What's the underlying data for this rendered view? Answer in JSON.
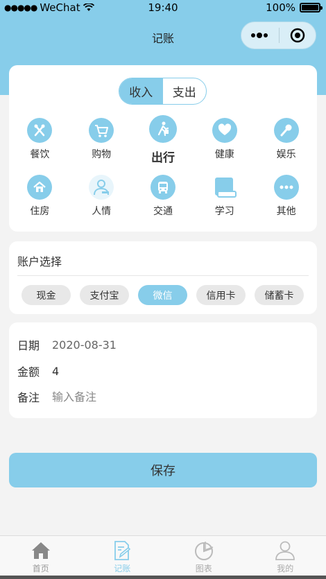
{
  "status_bar": {
    "carrier": "WeChat",
    "time": "19:40",
    "battery": "100%"
  },
  "nav": {
    "title": "记账"
  },
  "type_toggle": {
    "income_label": "收入",
    "expense_label": "支出",
    "selected": "收入"
  },
  "categories": [
    {
      "label": "餐饮",
      "icon": "utensils-icon"
    },
    {
      "label": "购物",
      "icon": "shopping-cart-icon"
    },
    {
      "label": "出行",
      "icon": "walking-person-icon",
      "selected": true
    },
    {
      "label": "健康",
      "icon": "heart-icon"
    },
    {
      "label": "娱乐",
      "icon": "microphone-icon"
    },
    {
      "label": "住房",
      "icon": "house-icon"
    },
    {
      "label": "人情",
      "icon": "person-icon"
    },
    {
      "label": "交通",
      "icon": "bus-icon"
    },
    {
      "label": "学习",
      "icon": "book-icon"
    },
    {
      "label": "其他",
      "icon": "more-dots-icon"
    }
  ],
  "account": {
    "title": "账户选择",
    "options": [
      "现金",
      "支付宝",
      "微信",
      "信用卡",
      "储蓄卡"
    ],
    "selected": "微信"
  },
  "form": {
    "date_label": "日期",
    "date_value": "2020-08-31",
    "amount_label": "金额",
    "amount_value": "4",
    "note_label": "备注",
    "note_placeholder": "输入备注"
  },
  "save_label": "保存",
  "tabbar": [
    {
      "label": "首页",
      "icon": "home-icon"
    },
    {
      "label": "记账",
      "icon": "edit-note-icon",
      "active": true
    },
    {
      "label": "图表",
      "icon": "pie-chart-icon"
    },
    {
      "label": "我的",
      "icon": "user-icon"
    }
  ],
  "colors": {
    "accent": "#87cdea",
    "background": "#f3f3f3"
  }
}
